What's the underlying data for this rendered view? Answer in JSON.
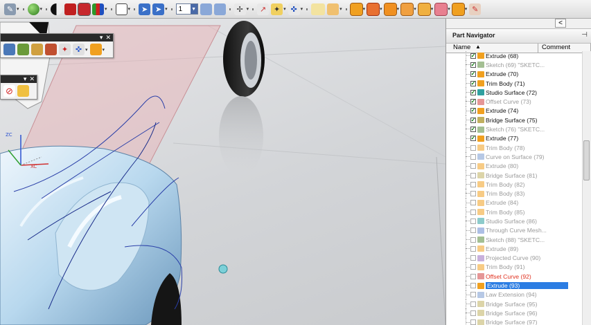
{
  "toolbar": {
    "icons": [
      "sketch-tool-icon",
      "sphere-icon",
      "shade-icon",
      "shade-red-icon",
      "view-cube-icon",
      "render-style-icon",
      "layer-box-icon",
      "select-arrow-icon",
      "select-arrow-alt-icon",
      "snap-icon",
      "orient-icon",
      "wcs-icon",
      "point-icon",
      "curve-icon",
      "curve-sketch-icon",
      "analysis-icon",
      "measure-icon",
      "surface-icon",
      "surface-red-icon",
      "surface-orange-icon",
      "surface-blend-icon",
      "surface-box-icon",
      "surface-pink-icon",
      "surface-face-icon",
      "surface-edit-icon"
    ],
    "layer_value": "1"
  },
  "float_toolbar_1": {
    "close": "✕",
    "menu": "▾"
  },
  "float_toolbar_2": {
    "close": "✕",
    "menu": "▾"
  },
  "viewport": {
    "csys_label_z": "ZC",
    "csys_label_x": "XC"
  },
  "navigator": {
    "collapse_label": "<",
    "title": "Part Navigator",
    "pin": "⊣",
    "columns": {
      "name": "Name",
      "comment": "Comment"
    },
    "items": [
      {
        "label": "Extrude (68)",
        "checked": true,
        "state": "normal",
        "icon": "extrude-icon"
      },
      {
        "label": "Sketch (69) \"SKETC...",
        "checked": true,
        "state": "dim",
        "icon": "sketch-icon"
      },
      {
        "label": "Extrude (70)",
        "checked": true,
        "state": "normal",
        "icon": "extrude-icon"
      },
      {
        "label": "Trim Body (71)",
        "checked": true,
        "state": "normal",
        "icon": "trim-body-icon"
      },
      {
        "label": "Studio Surface (72)",
        "checked": true,
        "state": "normal",
        "icon": "studio-surface-icon"
      },
      {
        "label": "Offset Curve (73)",
        "checked": true,
        "state": "dim",
        "icon": "offset-curve-icon"
      },
      {
        "label": "Extrude (74)",
        "checked": true,
        "state": "normal",
        "icon": "extrude-icon"
      },
      {
        "label": "Bridge Surface (75)",
        "checked": true,
        "state": "normal",
        "icon": "bridge-surface-icon"
      },
      {
        "label": "Sketch (76) \"SKETC...",
        "checked": true,
        "state": "dim",
        "icon": "sketch-icon"
      },
      {
        "label": "Extrude (77)",
        "checked": true,
        "state": "normal",
        "icon": "extrude-icon"
      },
      {
        "label": "Trim Body (78)",
        "checked": false,
        "state": "dim",
        "icon": "trim-body-icon"
      },
      {
        "label": "Curve on Surface (79)",
        "checked": false,
        "state": "dim",
        "icon": "curve-on-surface-icon"
      },
      {
        "label": "Extrude (80)",
        "checked": false,
        "state": "dim",
        "icon": "extrude-icon"
      },
      {
        "label": "Bridge Surface (81)",
        "checked": false,
        "state": "dim",
        "icon": "bridge-surface-icon"
      },
      {
        "label": "Trim Body (82)",
        "checked": false,
        "state": "dim",
        "icon": "trim-body-icon"
      },
      {
        "label": "Trim Body (83)",
        "checked": false,
        "state": "dim",
        "icon": "trim-body-icon"
      },
      {
        "label": "Extrude (84)",
        "checked": false,
        "state": "dim",
        "icon": "extrude-icon"
      },
      {
        "label": "Trim Body (85)",
        "checked": false,
        "state": "dim",
        "icon": "trim-body-icon"
      },
      {
        "label": "Studio Surface (86)",
        "checked": false,
        "state": "dim",
        "icon": "studio-surface-icon"
      },
      {
        "label": "Through Curve Mesh...",
        "checked": false,
        "state": "dim",
        "icon": "through-curve-mesh-icon"
      },
      {
        "label": "Sketch (88) \"SKETC...",
        "checked": false,
        "state": "dim",
        "icon": "sketch-icon"
      },
      {
        "label": "Extrude (89)",
        "checked": false,
        "state": "dim",
        "icon": "extrude-icon"
      },
      {
        "label": "Projected Curve (90)",
        "checked": false,
        "state": "dim",
        "icon": "projected-curve-icon"
      },
      {
        "label": "Trim Body (91)",
        "checked": false,
        "state": "dim",
        "icon": "trim-body-icon"
      },
      {
        "label": "Offset Curve (92)",
        "checked": false,
        "state": "red",
        "icon": "offset-curve-icon"
      },
      {
        "label": "Extrude (93)",
        "checked": false,
        "state": "selected",
        "icon": "extrude-icon"
      },
      {
        "label": "Law Extension (94)",
        "checked": false,
        "state": "dim",
        "icon": "law-extension-icon"
      },
      {
        "label": "Bridge Surface (95)",
        "checked": false,
        "state": "dim",
        "icon": "bridge-surface-icon"
      },
      {
        "label": "Bridge Surface (96)",
        "checked": false,
        "state": "dim",
        "icon": "bridge-surface-icon"
      },
      {
        "label": "Bridge Surface (97)",
        "checked": false,
        "state": "dim",
        "icon": "bridge-surface-icon"
      }
    ]
  },
  "colors": {
    "selection": "#2b7de3",
    "feature_orange": "#f0a020",
    "check_green": "#0a7a0a",
    "red_text": "#e0301e",
    "dim_text": "#9a9a9a"
  }
}
